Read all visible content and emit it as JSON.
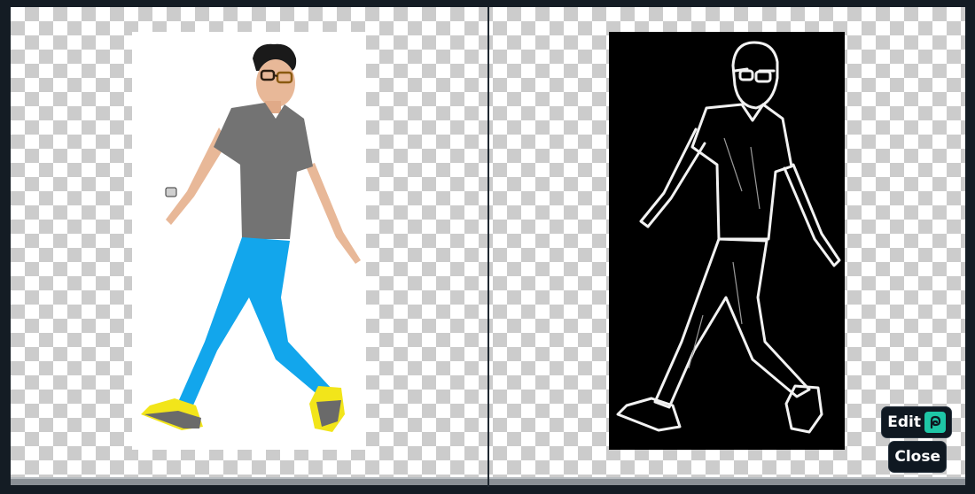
{
  "viewer": {
    "left_image": "original-illustration",
    "right_image": "glow-edges-result"
  },
  "controls": {
    "edit_label": "Edit",
    "edit_icon": "picsart-logo-icon",
    "close_label": "Close"
  },
  "colors": {
    "background": "#141c24",
    "button_bg": "#0f1821",
    "accent": "#1ec6a6",
    "shirt": "#737373",
    "jeans": "#12a6ec",
    "shoes": "#f2e51a"
  }
}
